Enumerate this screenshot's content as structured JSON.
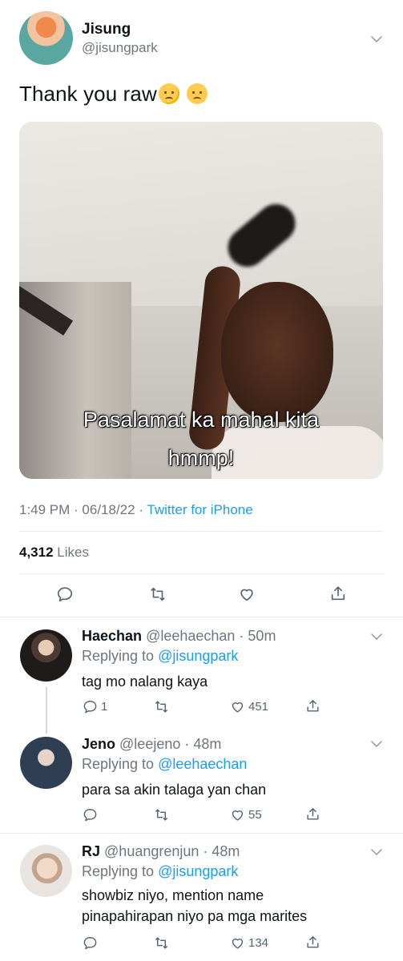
{
  "tweet": {
    "author_name": "Jisung",
    "author_handle": "@jisungpark",
    "text": "Thank you raw",
    "emojis": [
      "downcast-sweat-face-emoji",
      "sad-face-emoji"
    ],
    "media_caption_line1": "Pasalamat ka mahal kita",
    "media_caption_line2": "hmmp!",
    "time": "1:49 PM",
    "date": "06/18/22",
    "client": "Twitter for iPhone",
    "likes_count": "4,312",
    "likes_label": "Likes"
  },
  "replies": [
    {
      "name": "Haechan",
      "handle": "@leehaechan",
      "age": "50m",
      "replying_label": "Replying to",
      "replying_to": "@jisungpark",
      "text": "tag mo nalang kaya",
      "reply_count": "1",
      "retweet_count": "",
      "like_count": "451"
    },
    {
      "name": "Jeno",
      "handle": "@leejeno",
      "age": "48m",
      "replying_label": "Replying to",
      "replying_to": "@leehaechan",
      "text": "para sa akin talaga yan chan",
      "reply_count": "",
      "retweet_count": "",
      "like_count": "55"
    },
    {
      "name": "RJ",
      "handle": "@huangrenjun",
      "age": "48m",
      "replying_label": "Replying to",
      "replying_to": "@jisungpark",
      "text_line1": "showbiz niyo, mention name",
      "text_line2": "pinapahirapan niyo pa mga marites",
      "reply_count": "",
      "retweet_count": "",
      "like_count": "134"
    }
  ],
  "separator": " · ",
  "colors": {
    "accent": "#1d9bf0",
    "muted": "#6e767d",
    "text": "#0f1419",
    "divider": "#e6ecf0"
  },
  "icons": [
    "chevron-down-icon",
    "reply-icon",
    "retweet-icon",
    "like-icon",
    "share-icon"
  ]
}
